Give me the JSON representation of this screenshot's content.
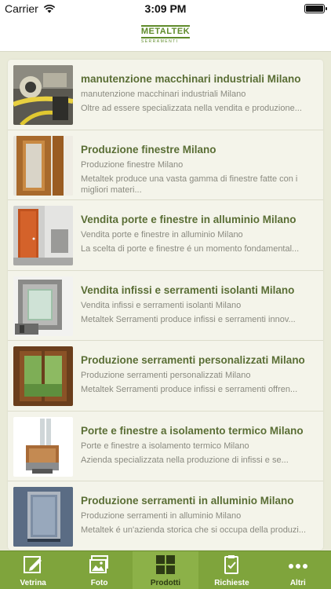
{
  "status_bar": {
    "carrier": "Carrier",
    "time": "3:09 PM",
    "wifi_icon": "wifi-icon",
    "battery_icon": "battery-icon"
  },
  "header": {
    "logo_word": "METALTEK",
    "logo_circle": "TEK",
    "logo_sub": "SERRAMENTI"
  },
  "list": {
    "items": [
      {
        "title": "manutenzione macchinari industriali Milano",
        "subtitle": "manutenzione macchinari industriali Milano",
        "description": "Oltre ad essere specializzata nella vendita e produzione...",
        "thumb": "industrial-machinery-photo"
      },
      {
        "title": "Produzione finestre Milano",
        "subtitle": "Produzione finestre Milano",
        "description": "Metaltek produce una vasta gamma di finestre fatte con i migliori materi...",
        "thumb": "wooden-window-photo"
      },
      {
        "title": "Vendita porte e finestre in alluminio Milano",
        "subtitle": "Vendita porte e finestre in alluminio Milano",
        "description": "La scelta di porte e finestre é un momento fondamental...",
        "thumb": "orange-door-photo"
      },
      {
        "title": "Vendita infissi e serramenti isolanti Milano",
        "subtitle": "Vendita infissi e serramenti isolanti Milano",
        "description": "Metaltek Serramenti produce infissi e serramenti innov...",
        "thumb": "aluminium-profile-photo"
      },
      {
        "title": "Produzione serramenti personalizzati Milano",
        "subtitle": "Produzione serramenti personalizzati Milano",
        "description": "Metaltek Serramenti produce infissi e serramenti offren...",
        "thumb": "wood-frame-window-photo"
      },
      {
        "title": "Porte e finestre a isolamento termico Milano",
        "subtitle": "Porte e finestre a isolamento termico Milano",
        "description": "Azienda specializzata nella produzione di infissi e se...",
        "thumb": "thermal-window-section-photo"
      },
      {
        "title": "Produzione serramenti in alluminio Milano",
        "subtitle": "Produzione serramenti in alluminio Milano",
        "description": "Metaltek é un'azienda storica che si occupa della produzi...",
        "thumb": "aluminium-window-photo"
      }
    ]
  },
  "tabbar": {
    "tabs": [
      {
        "label": "Vetrina",
        "icon": "edit-icon",
        "active": false
      },
      {
        "label": "Foto",
        "icon": "photo-icon",
        "active": false
      },
      {
        "label": "Prodotti",
        "icon": "grid-icon",
        "active": true
      },
      {
        "label": "Richieste",
        "icon": "clipboard-icon",
        "active": false
      },
      {
        "label": "Altri",
        "icon": "more-icon",
        "active": false
      }
    ]
  },
  "colors": {
    "accent": "#7fa43c",
    "title": "#5a6e35",
    "background": "#e9ead8"
  }
}
